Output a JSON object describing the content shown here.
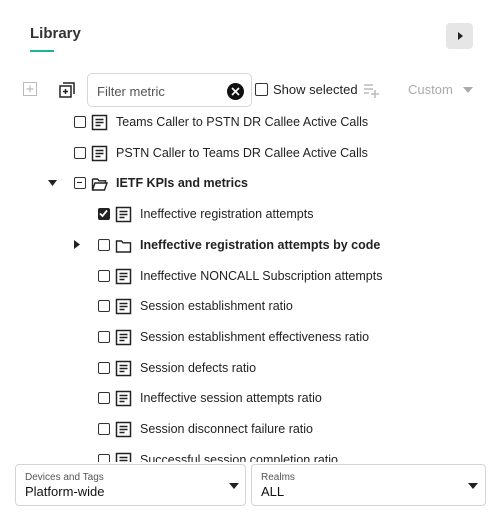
{
  "header": {
    "title": "Library"
  },
  "toolbar": {
    "filter_placeholder": "Filter metric",
    "show_selected_label": "Show selected",
    "custom_label": "Custom"
  },
  "tree": {
    "rows": [
      {
        "label": "Teams Caller to PSTN DR Callee Active Calls",
        "icon": "metric-doc-icon",
        "checked": false,
        "bold": false
      },
      {
        "label": "PSTN Caller to Teams DR Callee Active Calls",
        "icon": "metric-doc-icon",
        "checked": false,
        "bold": false
      },
      {
        "label": "IETF KPIs and metrics",
        "icon": "folder-open-icon",
        "checked": "partial",
        "bold": true,
        "arrow": "expanded"
      },
      {
        "label": "Ineffective registration attempts",
        "icon": "metric-doc-icon",
        "checked": true,
        "bold": false
      },
      {
        "label": "Ineffective registration attempts by code",
        "icon": "folder-icon",
        "checked": false,
        "bold": true,
        "arrow": "collapsed"
      },
      {
        "label": "Ineffective NONCALL Subscription attempts",
        "icon": "metric-doc-icon",
        "checked": false,
        "bold": false
      },
      {
        "label": "Session establishment ratio",
        "icon": "metric-doc-icon",
        "checked": false,
        "bold": false
      },
      {
        "label": "Session establishment effectiveness ratio",
        "icon": "metric-doc-icon",
        "checked": false,
        "bold": false
      },
      {
        "label": "Session defects ratio",
        "icon": "metric-doc-icon",
        "checked": false,
        "bold": false
      },
      {
        "label": "Ineffective session attempts ratio",
        "icon": "metric-doc-icon",
        "checked": false,
        "bold": false
      },
      {
        "label": "Session disconnect failure ratio",
        "icon": "metric-doc-icon",
        "checked": false,
        "bold": false
      },
      {
        "label": "Successful session completion ratio",
        "icon": "metric-doc-icon",
        "checked": false,
        "bold": false
      }
    ]
  },
  "footer": {
    "devices": {
      "caption": "Devices and Tags",
      "value": "Platform-wide"
    },
    "realms": {
      "caption": "Realms",
      "value": "ALL"
    }
  },
  "colors": {
    "accent": "#1ab394"
  }
}
